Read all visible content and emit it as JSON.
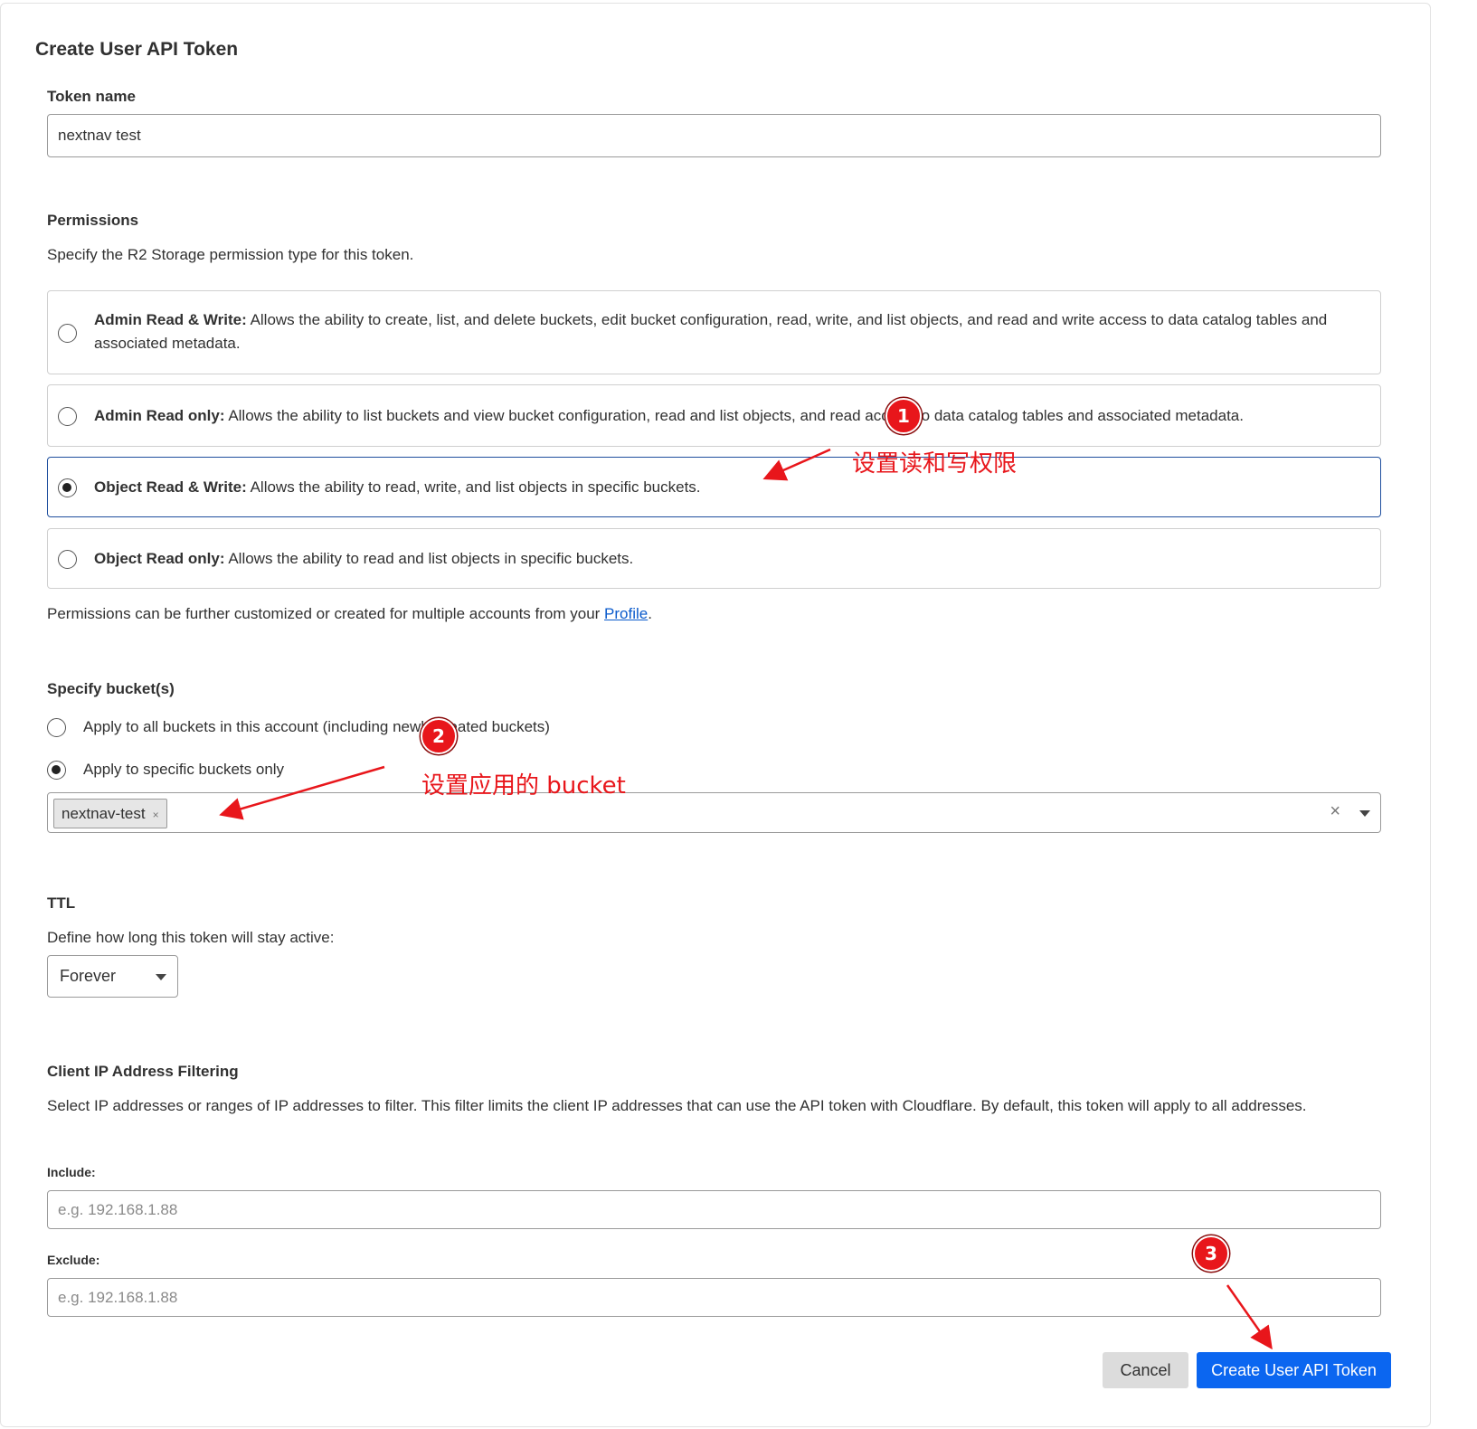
{
  "page_title": "Create User API Token",
  "token_name": {
    "label": "Token name",
    "value": "nextnav test"
  },
  "permissions": {
    "label": "Permissions",
    "description": "Specify the R2 Storage permission type for this token.",
    "options": [
      {
        "title": "Admin Read & Write:",
        "text": "Allows the ability to create, list, and delete buckets, edit bucket configuration, read, write, and list objects, and read and write access to data catalog tables and associated metadata.",
        "selected": false
      },
      {
        "title": "Admin Read only:",
        "text": "Allows the ability to list buckets and view bucket configuration, read and list objects, and read access to data catalog tables and associated metadata.",
        "selected": false
      },
      {
        "title": "Object Read & Write:",
        "text": "Allows the ability to read, write, and list objects in specific buckets.",
        "selected": true
      },
      {
        "title": "Object Read only:",
        "text": "Allows the ability to read and list objects in specific buckets.",
        "selected": false
      }
    ],
    "footnote_prefix": "Permissions can be further customized or created for multiple accounts from your ",
    "footnote_link": "Profile",
    "footnote_suffix": "."
  },
  "buckets": {
    "label": "Specify bucket(s)",
    "option_all": "Apply to all buckets in this account (including newly created buckets)",
    "option_specific": "Apply to specific buckets only",
    "selected_option": "specific",
    "selected_bucket": "nextnav-test",
    "chip_remove": "×",
    "clear": "×"
  },
  "ttl": {
    "label": "TTL",
    "description": "Define how long this token will stay active:",
    "value": "Forever"
  },
  "ip_filtering": {
    "label": "Client IP Address Filtering",
    "description": "Select IP addresses or ranges of IP addresses to filter. This filter limits the client IP addresses that can use the API token with Cloudflare. By default, this token will apply to all addresses.",
    "include_label": "Include:",
    "include_placeholder": "e.g. 192.168.1.88",
    "exclude_label": "Exclude:",
    "exclude_placeholder": "e.g. 192.168.1.88"
  },
  "actions": {
    "cancel": "Cancel",
    "create": "Create User API Token"
  },
  "annotations": {
    "badge1": "1",
    "note1": "设置读和写权限",
    "badge2": "2",
    "note2": "设置应用的 bucket",
    "badge3": "3",
    "color": "#e8161b"
  },
  "colors": {
    "primary": "#0b66f0",
    "selected_border": "#1f4f9e",
    "link": "#0b5bcc"
  }
}
